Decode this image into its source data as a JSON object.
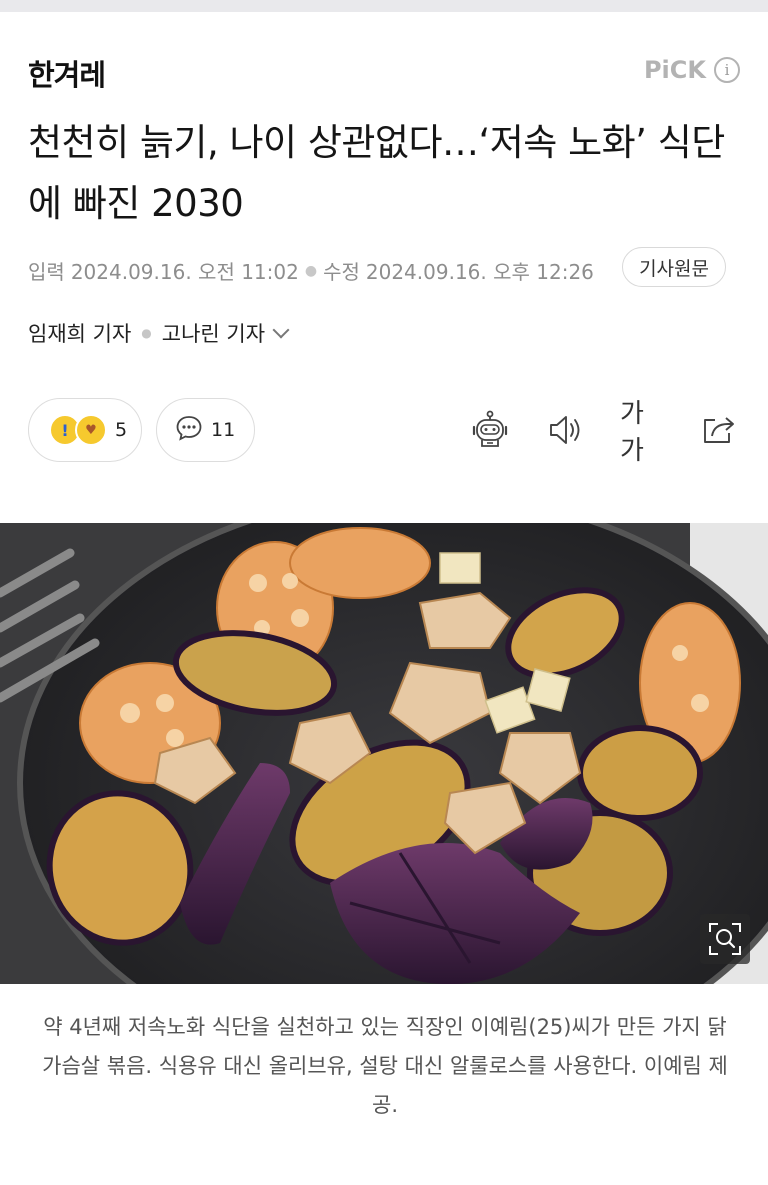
{
  "header": {
    "logo": "한겨레",
    "pick_label": "PiCK",
    "info_icon": "i"
  },
  "article": {
    "title": "천천히 늙기, 나이 상관없다…‘저속 노화’ 식단에 빠진 2030",
    "input_label": "입력",
    "input_time": "2024.09.16. 오전 11:02",
    "edit_label": "수정",
    "edit_time": "2024.09.16. 오후 12:26",
    "original_button": "기사원문",
    "reporters": [
      "임재희 기자",
      "고나린 기자"
    ],
    "reaction_count": "5",
    "comment_count": "11",
    "font_size_icon": "가가",
    "caption": "약 4년째 저속노화 식단을 실천하고 있는 직장인 이예림(25)씨가 만든 가지 닭가슴살 볶음. 식용유 대신 올리브유, 설탕 대신 알룰로스를 사용한다. 이예림 제공."
  },
  "icons": {
    "reaction_1": "surprised-emoji-icon",
    "reaction_2": "love-emoji-icon",
    "comment": "comment-bubble-icon",
    "robot": "ai-summary-robot-icon",
    "speaker": "text-to-speech-icon",
    "font": "font-size-icon",
    "share": "share-icon",
    "zoom": "zoom-image-icon"
  },
  "colors": {
    "logo": "#111111",
    "pick": "#b3b3b3",
    "meta": "#8d8d8d",
    "caption": "#555555"
  }
}
